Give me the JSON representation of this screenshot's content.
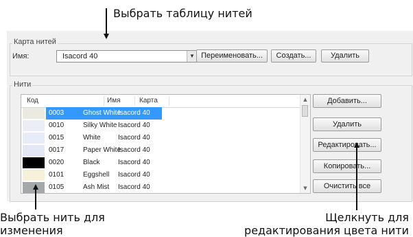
{
  "callouts": {
    "top": "Выбрать таблицу нитей",
    "left": [
      "Выбрать нить для",
      "изменения"
    ],
    "right": [
      "Щелкнуть для",
      "редактирования цвета нити"
    ]
  },
  "thread_chart_group": {
    "title": "Карта нитей",
    "name_label": "Имя:",
    "combo_value": "Isacord 40",
    "buttons": {
      "rename": "Переименовать...",
      "create": "Создать...",
      "delete": "Удалить"
    }
  },
  "threads_group": {
    "title": "Нити",
    "columns": [
      "Код",
      "Имя",
      "Карта"
    ],
    "rows": [
      {
        "swatch": "#eaeae0",
        "code": "0003",
        "name": "Ghost White",
        "chart": "Isacord 40",
        "selected": true
      },
      {
        "swatch": "#ebeef7",
        "code": "0010",
        "name": "Silky White",
        "chart": "Isacord 40",
        "selected": false
      },
      {
        "swatch": "#e6ecf8",
        "code": "0015",
        "name": "White",
        "chart": "Isacord 40",
        "selected": false
      },
      {
        "swatch": "#e4e8f4",
        "code": "0017",
        "name": "Paper White",
        "chart": "Isacord 40",
        "selected": false
      },
      {
        "swatch": "#000000",
        "code": "0020",
        "name": "Black",
        "chart": "Isacord 40",
        "selected": false
      },
      {
        "swatch": "#f7f1dc",
        "code": "0101",
        "name": "Eggshell",
        "chart": "Isacord 40",
        "selected": false
      },
      {
        "swatch": "#a4a8a9",
        "code": "0105",
        "name": "Ash Mist",
        "chart": "Isacord 40",
        "selected": false
      }
    ],
    "buttons": {
      "add": "Добавить...",
      "delete": "Удалить",
      "edit": "Редактировать...",
      "copy": "Копировать...",
      "clear_all": "Очистить все"
    }
  },
  "icons": {
    "combo_dropdown": "▼",
    "scroll_up": "▲",
    "scroll_down": "▼"
  },
  "colors": {
    "selection": "#3399ff"
  }
}
